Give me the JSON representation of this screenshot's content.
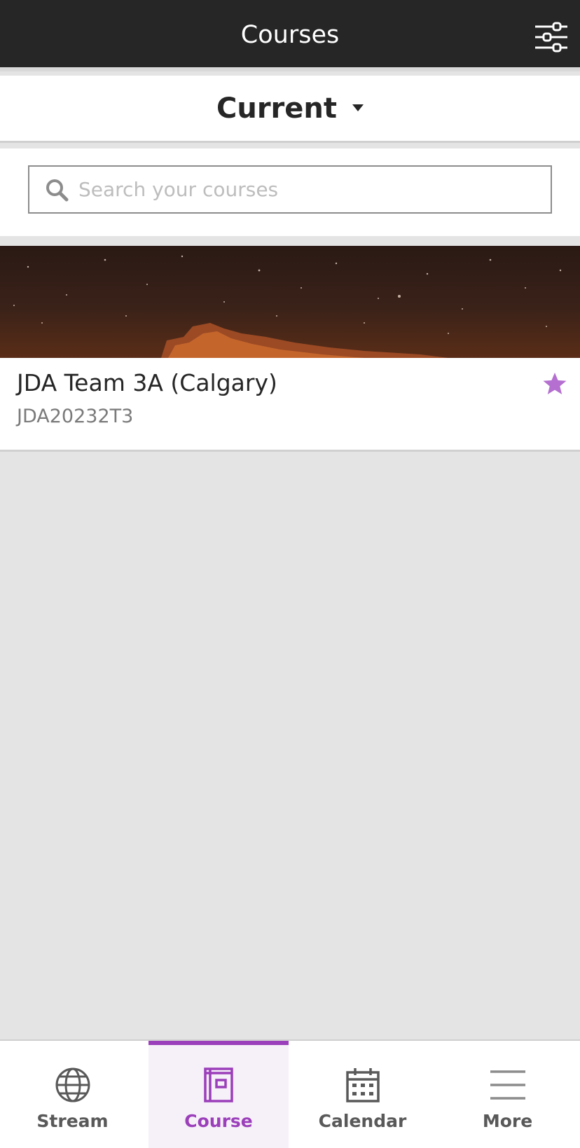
{
  "header": {
    "title": "Courses",
    "filter_icon": "sliders-icon"
  },
  "term_selector": {
    "label": "Current"
  },
  "search": {
    "placeholder": "Search your courses",
    "value": ""
  },
  "courses": [
    {
      "title": "JDA Team 3A (Calgary)",
      "code": "JDA20232T3",
      "favorite": true
    }
  ],
  "bottom_nav": [
    {
      "label": "Stream",
      "icon": "globe-icon",
      "active": false
    },
    {
      "label": "Course",
      "icon": "book-icon",
      "active": true
    },
    {
      "label": "Calendar",
      "icon": "calendar-icon",
      "active": false
    },
    {
      "label": "More",
      "icon": "menu-icon",
      "active": false
    }
  ],
  "colors": {
    "accent": "#9b3fba",
    "header_bg": "#262626",
    "star": "#b46fd0"
  }
}
